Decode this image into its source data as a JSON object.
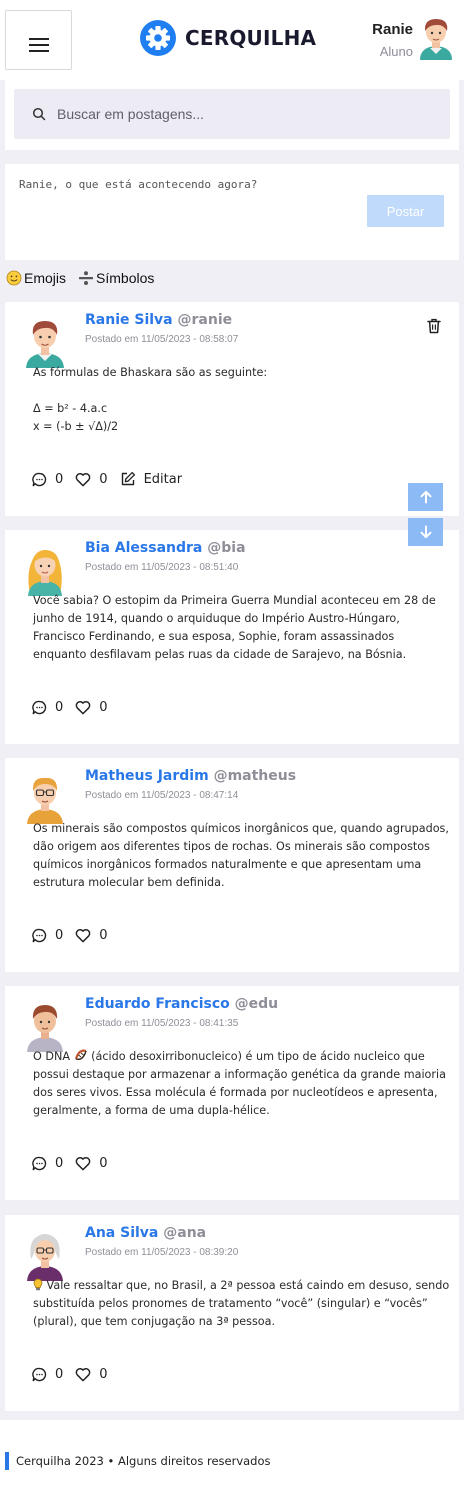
{
  "header": {
    "logo_text": "CERQUILHA",
    "user_name": "Ranie",
    "user_role": "Aluno"
  },
  "search": {
    "placeholder": "Buscar em postagens..."
  },
  "compose": {
    "placeholder": "Ranie, o que está acontecendo agora?",
    "post_label": "Postar"
  },
  "tools": {
    "emojis_label": "Emojis",
    "symbols_label": "Símbolos"
  },
  "posts": [
    {
      "name": "Ranie Silva",
      "handle": "@ranie",
      "date": "Postado em 11/05/2023 - 08:58:07",
      "body": "As fórmulas de Bhaskara são as seguinte:\n\nΔ = b² - 4.a.c\nx = (-b ± √Δ)/2",
      "comments": "0",
      "likes": "0",
      "edit_label": "Editar"
    },
    {
      "name": "Bia Alessandra",
      "handle": "@bia",
      "date": "Postado em 11/05/2023 - 08:51:40",
      "body": "Você sabia? O estopim da Primeira Guerra Mundial aconteceu em 28 de junho de 1914, quando o arquiduque do Império Austro-Húngaro, Francisco Ferdinando, e sua esposa, Sophie, foram assassinados enquanto desfilavam pelas ruas da cidade de Sarajevo, na Bósnia.",
      "comments": "0",
      "likes": "0"
    },
    {
      "name": "Matheus Jardim",
      "handle": "@matheus",
      "date": "Postado em 11/05/2023 - 08:47:14",
      "body": "Os minerais são compostos químicos inorgânicos que, quando agrupados, dão origem aos diferentes tipos de rochas. Os minerais são compostos químicos inorgânicos formados naturalmente e que apresentam uma estrutura molecular bem definida.",
      "comments": "0",
      "likes": "0"
    },
    {
      "name": "Eduardo Francisco",
      "handle": "@edu",
      "date": "Postado em 11/05/2023 - 08:41:35",
      "body_before": "O DNA ",
      "body_after": " (ácido desoxirribonucleico) é um tipo de ácido nucleico que possui destaque por armazenar a informação genética da grande maioria dos seres vivos. Essa molécula é formada por nucleotídeos e apresenta, geralmente, a forma de uma dupla-hélice.",
      "comments": "0",
      "likes": "0"
    },
    {
      "name": "Ana Silva",
      "handle": "@ana",
      "date": "Postado em 11/05/2023 - 08:39:20",
      "body_after": " Vale ressaltar que, no Brasil, a 2ª pessoa está caindo em desuso, sendo substituída pelos pronomes de tratamento “você” (singular) e “vocês” (plural), que tem conjugação na 3ª pessoa.",
      "comments": "0",
      "likes": "0"
    }
  ],
  "footer": {
    "text": "Cerquilha 2023 • Alguns direitos reservados"
  },
  "colors": {
    "accent": "#2a77e8",
    "page_bg": "#f0eff6",
    "handle_gray": "#8e8e98",
    "post_button_disabled": "#c0dafb",
    "scroll_button": "#8cbaf5"
  },
  "icons": {
    "menu": "hamburger-icon",
    "logo": "gear-icon",
    "search": "search-icon",
    "emoji": "smiley-icon",
    "symbols": "divide-icon",
    "comment": "comment-bubble-icon",
    "like": "heart-icon",
    "edit": "edit-pencil-icon",
    "delete": "trash-icon",
    "scroll_up": "arrow-up-icon",
    "scroll_down": "arrow-down-icon"
  }
}
